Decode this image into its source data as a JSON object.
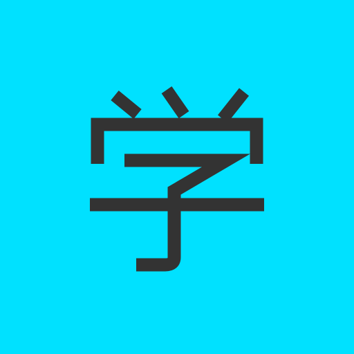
{
  "icon": {
    "character": "学",
    "background_color": "#00E1FF",
    "glyph_color": "#333333"
  }
}
